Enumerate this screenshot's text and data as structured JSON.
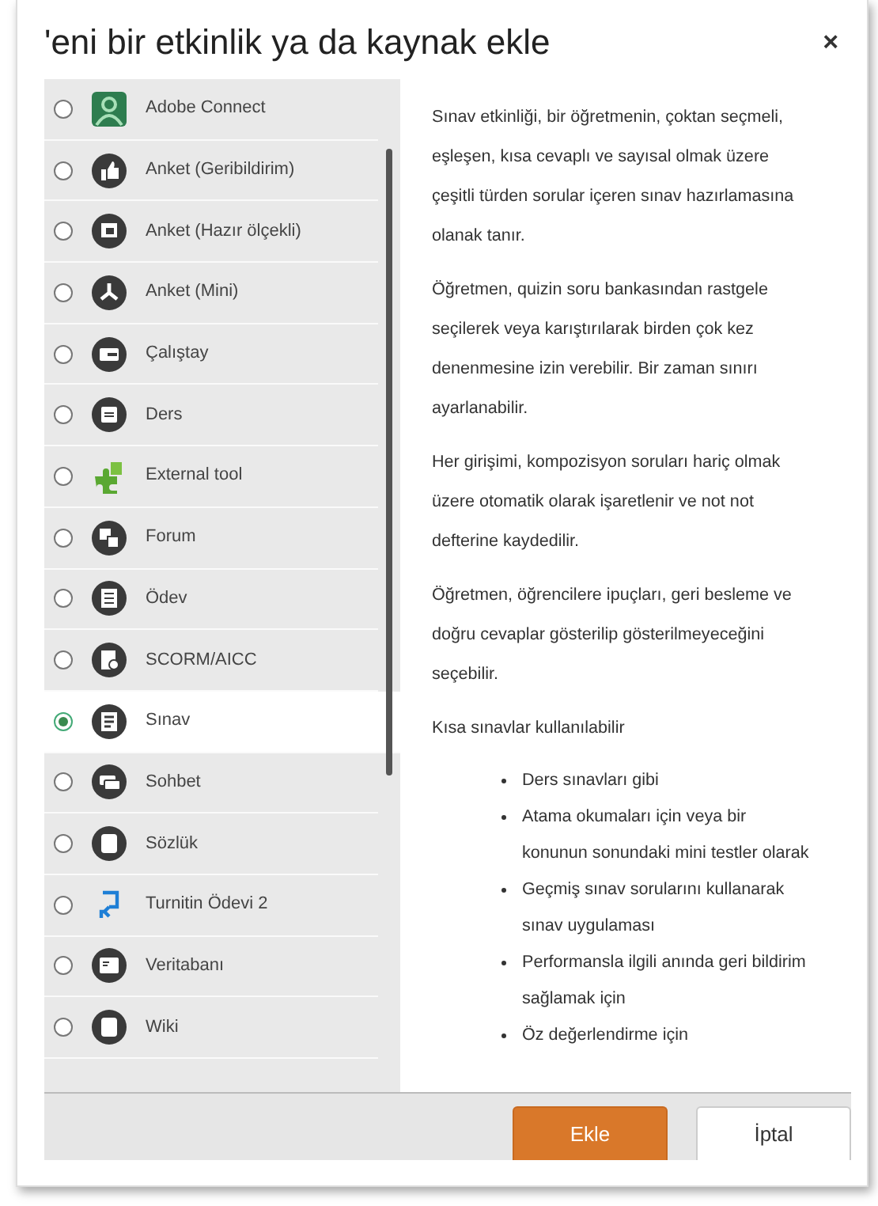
{
  "dialog": {
    "title": "'eni bir etkinlik ya da kaynak ekle",
    "close": "×"
  },
  "items": [
    {
      "label": "Adobe Connect",
      "kind": "adobe",
      "selected": false
    },
    {
      "label": "Anket (Geribildirim)",
      "kind": "thumb",
      "selected": false
    },
    {
      "label": "Anket (Hazır ölçekli)",
      "kind": "screen",
      "selected": false
    },
    {
      "label": "Anket (Mini)",
      "kind": "mini",
      "selected": false
    },
    {
      "label": "Çalıştay",
      "kind": "workshop",
      "selected": false
    },
    {
      "label": "Ders",
      "kind": "page",
      "selected": false
    },
    {
      "label": "External tool",
      "kind": "puzzle",
      "selected": false
    },
    {
      "label": "Forum",
      "kind": "forum",
      "selected": false
    },
    {
      "label": "Ödev",
      "kind": "list",
      "selected": false
    },
    {
      "label": "SCORM/AICC",
      "kind": "scorm",
      "selected": false
    },
    {
      "label": "Sınav",
      "kind": "quiz",
      "selected": true
    },
    {
      "label": "Sohbet",
      "kind": "chat",
      "selected": false
    },
    {
      "label": "Sözlük",
      "kind": "book",
      "selected": false
    },
    {
      "label": "Turnitin Ödevi 2",
      "kind": "turnitin",
      "selected": false
    },
    {
      "label": "Veritabanı",
      "kind": "db",
      "selected": false
    },
    {
      "label": "Wiki",
      "kind": "book",
      "selected": false
    }
  ],
  "description": {
    "paragraphs": [
      "Sınav etkinliği, bir öğretmenin, çoktan seçmeli, eşleşen, kısa cevaplı ve sayısal olmak üzere çeşitli türden sorular içeren sınav hazırlamasına olanak tanır.",
      "Öğretmen, quizin soru bankasından rastgele seçilerek veya karıştırılarak birden çok kez denenmesine izin verebilir. Bir zaman sınırı ayarlanabilir.",
      "Her girişimi, kompozisyon soruları hariç olmak üzere otomatik olarak işaretlenir ve not not defterine kaydedilir.",
      "Öğretmen, öğrencilere ipuçları, geri besleme ve doğru cevaplar gösterilip gösterilmeyeceğini seçebilir.",
      "Kısa sınavlar kullanılabilir"
    ],
    "bullets": [
      "Ders sınavları gibi",
      "Atama okumaları için veya bir konunun sonundaki mini testler olarak",
      "Geçmiş sınav sorularını kullanarak sınav uygulaması",
      "Performansla ilgili anında geri bildirim sağlamak için",
      "Öz değerlendirme için"
    ]
  },
  "buttons": [
    {
      "label": "Ekle",
      "kind": "primary"
    },
    {
      "label": "İptal",
      "kind": "secondary"
    }
  ]
}
